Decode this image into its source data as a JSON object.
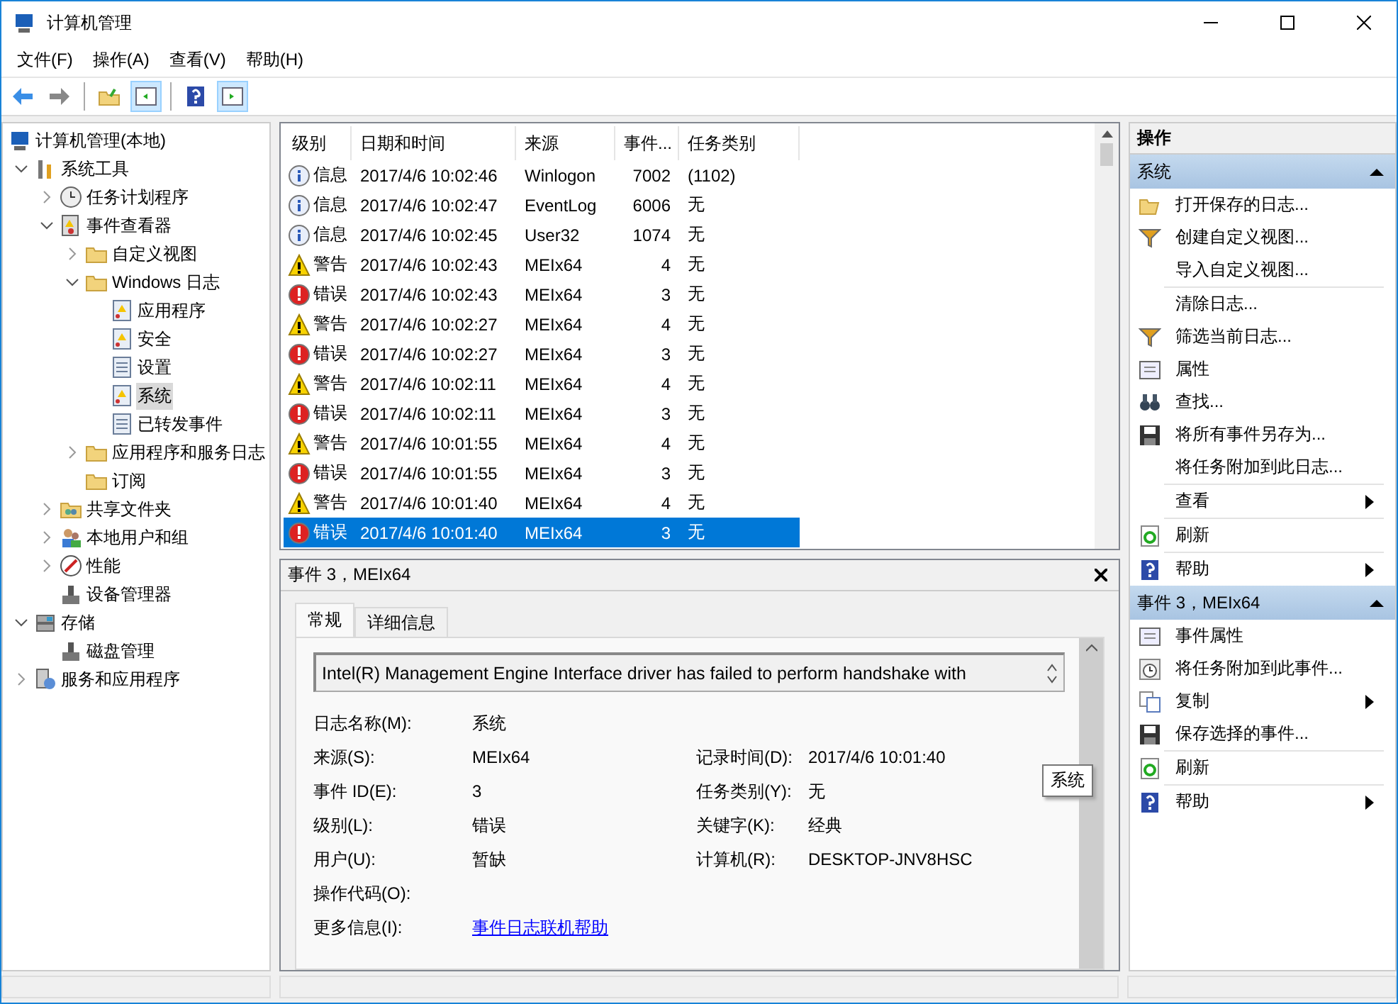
{
  "window": {
    "title": "计算机管理"
  },
  "menu": [
    "文件(F)",
    "操作(A)",
    "查看(V)",
    "帮助(H)"
  ],
  "tree": [
    {
      "label": "计算机管理(本地)",
      "kind": "computer",
      "selected": false,
      "children": [
        {
          "label": "系统工具",
          "kind": "tool",
          "selected": false,
          "expanded": true,
          "children": [
            {
              "label": "任务计划程序",
              "kind": "clock",
              "selected": false,
              "expanded": false
            },
            {
              "label": "事件查看器",
              "kind": "viewer",
              "selected": false,
              "expanded": true,
              "children": [
                {
                  "label": "自定义视图",
                  "kind": "folder",
                  "selected": false,
                  "expanded": false
                },
                {
                  "label": "Windows 日志",
                  "kind": "folder",
                  "selected": false,
                  "expanded": true,
                  "children": [
                    {
                      "label": "应用程序",
                      "kind": "log",
                      "selected": false
                    },
                    {
                      "label": "安全",
                      "kind": "log",
                      "selected": false
                    },
                    {
                      "label": "设置",
                      "kind": "doc",
                      "selected": false
                    },
                    {
                      "label": "系统",
                      "kind": "log",
                      "selected": true
                    },
                    {
                      "label": "已转发事件",
                      "kind": "doc",
                      "selected": false
                    }
                  ]
                },
                {
                  "label": "应用程序和服务日志",
                  "kind": "folder",
                  "selected": false,
                  "expanded": false
                },
                {
                  "label": "订阅",
                  "kind": "folder",
                  "selected": false
                }
              ]
            },
            {
              "label": "共享文件夹",
              "kind": "share",
              "selected": false,
              "expanded": false
            },
            {
              "label": "本地用户和组",
              "kind": "users",
              "selected": false,
              "expanded": false
            },
            {
              "label": "性能",
              "kind": "perf",
              "selected": false,
              "expanded": false
            },
            {
              "label": "设备管理器",
              "kind": "device",
              "selected": false
            }
          ]
        },
        {
          "label": "存储",
          "kind": "storage",
          "selected": false,
          "expanded": true,
          "children": [
            {
              "label": "磁盘管理",
              "kind": "device",
              "selected": false
            }
          ]
        },
        {
          "label": "服务和应用程序",
          "kind": "service",
          "selected": false,
          "expanded": false
        }
      ]
    }
  ],
  "events": {
    "columns": [
      "级别",
      "日期和时间",
      "来源",
      "事件...",
      "任务类别"
    ],
    "rows": [
      {
        "kind": "info",
        "level": "信息",
        "time": "2017/4/6 10:02:46",
        "source": "Winlogon",
        "id": "7002",
        "category": "(1102)",
        "selected": false
      },
      {
        "kind": "info",
        "level": "信息",
        "time": "2017/4/6 10:02:47",
        "source": "EventLog",
        "id": "6006",
        "category": "无",
        "selected": false
      },
      {
        "kind": "info",
        "level": "信息",
        "time": "2017/4/6 10:02:45",
        "source": "User32",
        "id": "1074",
        "category": "无",
        "selected": false
      },
      {
        "kind": "warning",
        "level": "警告",
        "time": "2017/4/6 10:02:43",
        "source": "MEIx64",
        "id": "4",
        "category": "无",
        "selected": false
      },
      {
        "kind": "error",
        "level": "错误",
        "time": "2017/4/6 10:02:43",
        "source": "MEIx64",
        "id": "3",
        "category": "无",
        "selected": false
      },
      {
        "kind": "warning",
        "level": "警告",
        "time": "2017/4/6 10:02:27",
        "source": "MEIx64",
        "id": "4",
        "category": "无",
        "selected": false
      },
      {
        "kind": "error",
        "level": "错误",
        "time": "2017/4/6 10:02:27",
        "source": "MEIx64",
        "id": "3",
        "category": "无",
        "selected": false
      },
      {
        "kind": "warning",
        "level": "警告",
        "time": "2017/4/6 10:02:11",
        "source": "MEIx64",
        "id": "4",
        "category": "无",
        "selected": false
      },
      {
        "kind": "error",
        "level": "错误",
        "time": "2017/4/6 10:02:11",
        "source": "MEIx64",
        "id": "3",
        "category": "无",
        "selected": false
      },
      {
        "kind": "warning",
        "level": "警告",
        "time": "2017/4/6 10:01:55",
        "source": "MEIx64",
        "id": "4",
        "category": "无",
        "selected": false
      },
      {
        "kind": "error",
        "level": "错误",
        "time": "2017/4/6 10:01:55",
        "source": "MEIx64",
        "id": "3",
        "category": "无",
        "selected": false
      },
      {
        "kind": "warning",
        "level": "警告",
        "time": "2017/4/6 10:01:40",
        "source": "MEIx64",
        "id": "4",
        "category": "无",
        "selected": false
      },
      {
        "kind": "error",
        "level": "错误",
        "time": "2017/4/6 10:01:40",
        "source": "MEIx64",
        "id": "3",
        "category": "无",
        "selected": true
      }
    ]
  },
  "detail": {
    "title": "事件 3，MEIx64",
    "tabs": [
      {
        "label": "常规",
        "selected": true
      },
      {
        "label": "详细信息",
        "selected": false
      }
    ],
    "message": "Intel(R) Management Engine Interface driver has failed to perform handshake with",
    "fields": [
      {
        "label": "日志名称(M):",
        "value": "系统"
      },
      {
        "label": "来源(S):",
        "value": "MEIx64"
      },
      {
        "label": "记录时间(D):",
        "value": "2017/4/6 10:01:40"
      },
      {
        "label": "事件 ID(E):",
        "value": "3"
      },
      {
        "label": "任务类别(Y):",
        "value": "无"
      },
      {
        "label": "级别(L):",
        "value": "错误"
      },
      {
        "label": "关键字(K):",
        "value": "经典"
      },
      {
        "label": "用户(U):",
        "value": "暂缺"
      },
      {
        "label": "计算机(R):",
        "value": "DESKTOP-JNV8HSC"
      },
      {
        "label": "操作代码(O):"
      }
    ],
    "more_info": {
      "label": "更多信息(I):",
      "link": "事件日志联机帮助"
    },
    "tooltip": "系统"
  },
  "actions": {
    "title": "操作",
    "sections": [
      {
        "title": "系统",
        "expanded": true,
        "items": [
          {
            "label": "打开保存的日志...",
            "kind": "open"
          },
          {
            "label": "创建自定义视图...",
            "kind": "filter"
          },
          {
            "label": "导入自定义视图...",
            "kind": "plain",
            "divider": true
          },
          {
            "label": "清除日志...",
            "kind": "plain"
          },
          {
            "label": "筛选当前日志...",
            "kind": "filter"
          },
          {
            "label": "属性",
            "kind": "props"
          },
          {
            "label": "查找...",
            "kind": "find"
          },
          {
            "label": "将所有事件另存为...",
            "kind": "save"
          },
          {
            "label": "将任务附加到此日志...",
            "kind": "plain",
            "divider": true
          },
          {
            "label": "查看",
            "kind": "plain",
            "submenu": true,
            "divider": true
          },
          {
            "label": "刷新",
            "kind": "refresh",
            "divider": true
          },
          {
            "label": "帮助",
            "kind": "help",
            "submenu": true
          }
        ]
      },
      {
        "title": "事件 3，MEIx64",
        "expanded": true,
        "items": [
          {
            "label": "事件属性",
            "kind": "props"
          },
          {
            "label": "将任务附加到此事件...",
            "kind": "clock"
          },
          {
            "label": "复制",
            "kind": "copy",
            "submenu": true
          },
          {
            "label": "保存选择的事件...",
            "kind": "save",
            "divider": true
          },
          {
            "label": "刷新",
            "kind": "refresh",
            "divider": true
          },
          {
            "label": "帮助",
            "kind": "help",
            "submenu": true
          }
        ]
      }
    ]
  }
}
